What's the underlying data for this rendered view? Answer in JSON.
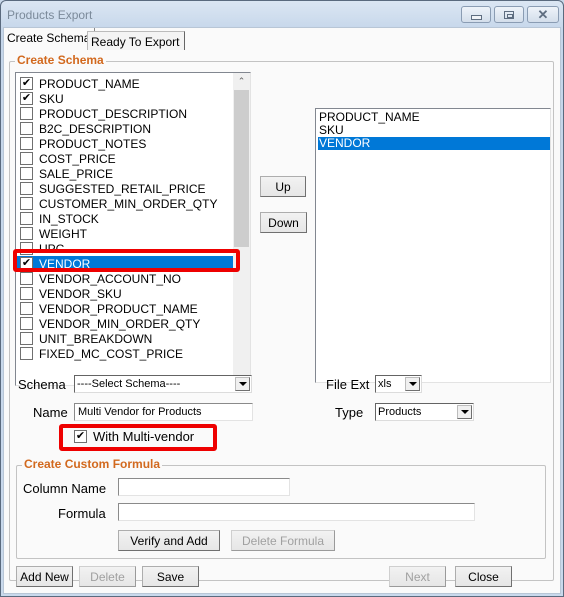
{
  "window": {
    "title": "Products Export",
    "controls": {
      "minimize": "minimize-icon",
      "maximize": "maximize-icon",
      "close": "close-icon"
    }
  },
  "tabs": [
    {
      "label": "Create Schema",
      "active": true
    },
    {
      "label": "Ready To Export",
      "active": false
    }
  ],
  "schema_group": {
    "title": "Create Schema"
  },
  "field_list": {
    "items": [
      {
        "label": "PRODUCT_NAME",
        "checked": true
      },
      {
        "label": "SKU",
        "checked": true
      },
      {
        "label": "PRODUCT_DESCRIPTION",
        "checked": false
      },
      {
        "label": "B2C_DESCRIPTION",
        "checked": false
      },
      {
        "label": "PRODUCT_NOTES",
        "checked": false
      },
      {
        "label": "COST_PRICE",
        "checked": false
      },
      {
        "label": "SALE_PRICE",
        "checked": false
      },
      {
        "label": "SUGGESTED_RETAIL_PRICE",
        "checked": false
      },
      {
        "label": "CUSTOMER_MIN_ORDER_QTY",
        "checked": false
      },
      {
        "label": "IN_STOCK",
        "checked": false
      },
      {
        "label": "WEIGHT",
        "checked": false
      },
      {
        "label": "UPC",
        "checked": false
      },
      {
        "label": "VENDOR",
        "checked": true,
        "selected": true,
        "highlighted": true
      },
      {
        "label": "VENDOR_ACCOUNT_NO",
        "checked": false
      },
      {
        "label": "VENDOR_SKU",
        "checked": false
      },
      {
        "label": "VENDOR_PRODUCT_NAME",
        "checked": false
      },
      {
        "label": "VENDOR_MIN_ORDER_QTY",
        "checked": false
      },
      {
        "label": "UNIT_BREAKDOWN",
        "checked": false
      },
      {
        "label": "FIXED_MC_COST_PRICE",
        "checked": false
      }
    ],
    "check_glyph": "✔",
    "scroll_up_glyph": "⌃",
    "scroll_down_glyph": "⌄"
  },
  "order_buttons": {
    "up": "Up",
    "down": "Down"
  },
  "selected_list": {
    "items": [
      {
        "label": "PRODUCT_NAME",
        "selected": false
      },
      {
        "label": "SKU",
        "selected": false
      },
      {
        "label": "VENDOR",
        "selected": true
      }
    ]
  },
  "form": {
    "schema_label": "Schema",
    "schema_value": "----Select Schema----",
    "name_label": "Name",
    "name_value": "Multi Vendor for Products",
    "multi_vendor_label": "With Multi-vendor",
    "multi_vendor_checked": true,
    "file_ext_label": "File Ext",
    "file_ext_value": "xls",
    "type_label": "Type",
    "type_value": "Products"
  },
  "formula_group": {
    "title": "Create Custom Formula",
    "column_name_label": "Column Name",
    "column_name_value": "",
    "formula_label": "Formula",
    "formula_value": "",
    "verify_button": "Verify and Add",
    "delete_button": "Delete Formula"
  },
  "footer": {
    "add_new": "Add New",
    "delete": "Delete",
    "save": "Save",
    "next": "Next",
    "close": "Close"
  },
  "colors": {
    "accent_legend": "#d2691e",
    "selection": "#0078d7",
    "annotation_red": "#ee0000"
  }
}
